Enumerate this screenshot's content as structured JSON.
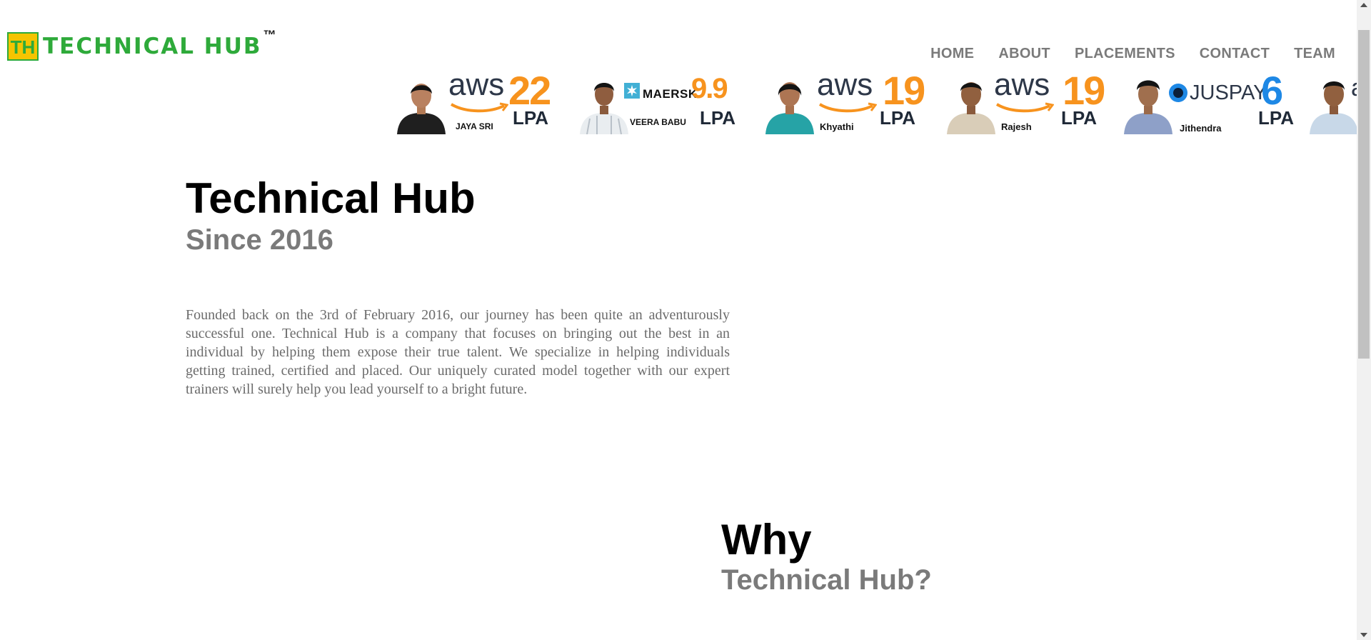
{
  "brand": {
    "logo_letters": "TH",
    "name": "TECHNICAL HUB",
    "trademark": "™"
  },
  "nav": {
    "items": [
      "HOME",
      "ABOUT",
      "PLACEMENTS",
      "CONTACT",
      "TEAM"
    ]
  },
  "placements": [
    {
      "name": "JAYA SRI",
      "company": "aws",
      "package": "22",
      "unit": "LPA"
    },
    {
      "name": "VEERA BABU",
      "company": "MAERSK",
      "package": "9.9",
      "unit": "LPA"
    },
    {
      "name": "Khyathi",
      "company": "aws",
      "package": "19",
      "unit": "LPA"
    },
    {
      "name": "Rajesh",
      "company": "aws",
      "package": "19",
      "unit": "LPA"
    },
    {
      "name": "Jithendra",
      "company": "JUSPAY",
      "package": "6",
      "unit": "LPA"
    },
    {
      "name": "",
      "company": "a",
      "package": "",
      "unit": ""
    }
  ],
  "hero": {
    "title": "Technical Hub",
    "subtitle": "Since 2016",
    "paragraph": "Founded back on the 3rd of February 2016, our journey has been quite an adventurously successful one. Technical Hub is a company that focuses on bringing out the best in an individual by helping them expose their true talent. We specialize in helping individuals getting trained, certified and placed. Our uniquely curated model together with our expert trainers will surely help you lead yourself to a bright future."
  },
  "why": {
    "title": "Why",
    "subtitle": "Technical Hub?"
  },
  "colors": {
    "brand_green": "#2eaa3a",
    "logo_yellow": "#f5c400",
    "accent_orange": "#f7931e",
    "nav_gray": "#7a7a7a"
  },
  "icons": [
    "logo-mark-icon",
    "aws-smile-icon",
    "maersk-star-icon",
    "juspay-icon"
  ]
}
